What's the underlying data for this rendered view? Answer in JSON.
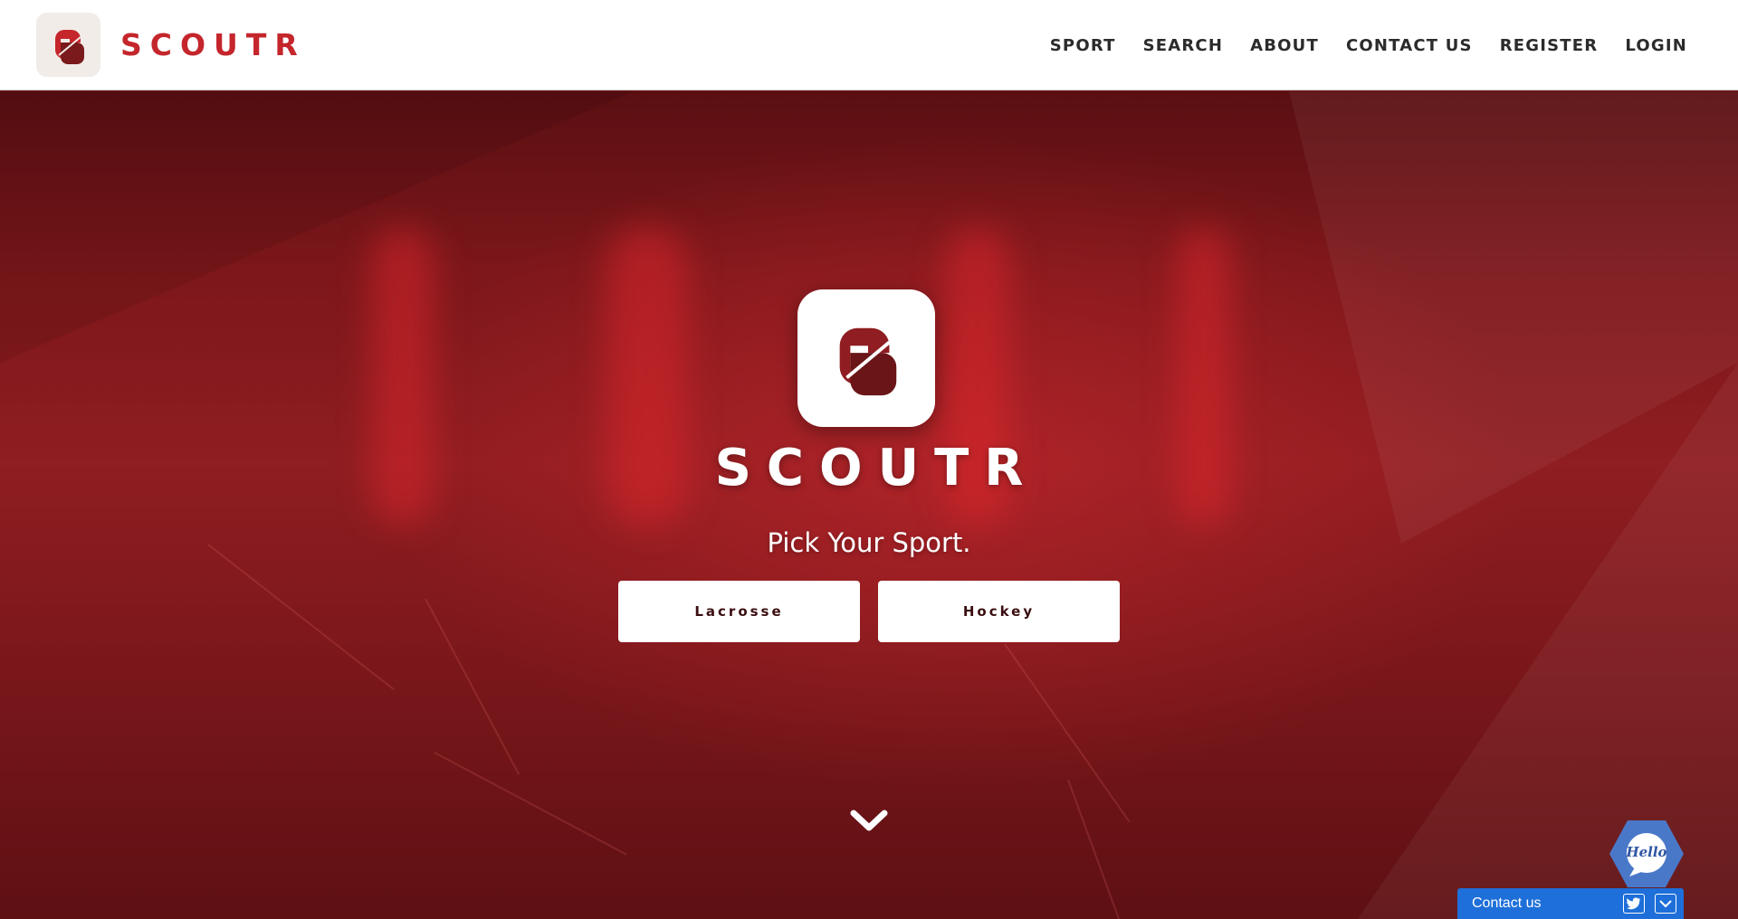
{
  "header": {
    "brand_name": "SCOUTR",
    "nav": [
      "SPORT",
      "SEARCH",
      "ABOUT",
      "CONTACT US",
      "REGISTER",
      "LOGIN"
    ]
  },
  "hero": {
    "wordmark": "SCOUTR",
    "tagline": "Pick Your Sport.",
    "buttons": [
      "Lacrosse",
      "Hockey"
    ]
  },
  "widgets": {
    "hello_label": "Hello",
    "contact_label": "Contact us"
  },
  "icons": {
    "brand_logo": "scoutr-logo-icon",
    "scroll": "chevron-down-icon",
    "hello": "hello-chat-bubble-icon",
    "twitter": "twitter-icon",
    "minimize": "chevron-down-icon"
  },
  "colors": {
    "brand_red": "#c4262c",
    "logo_dark": "#7a1a1c",
    "hero_red": "#8f1d21",
    "widget_blue": "#1e6fd9",
    "hello_blue": "#4a78c9"
  }
}
